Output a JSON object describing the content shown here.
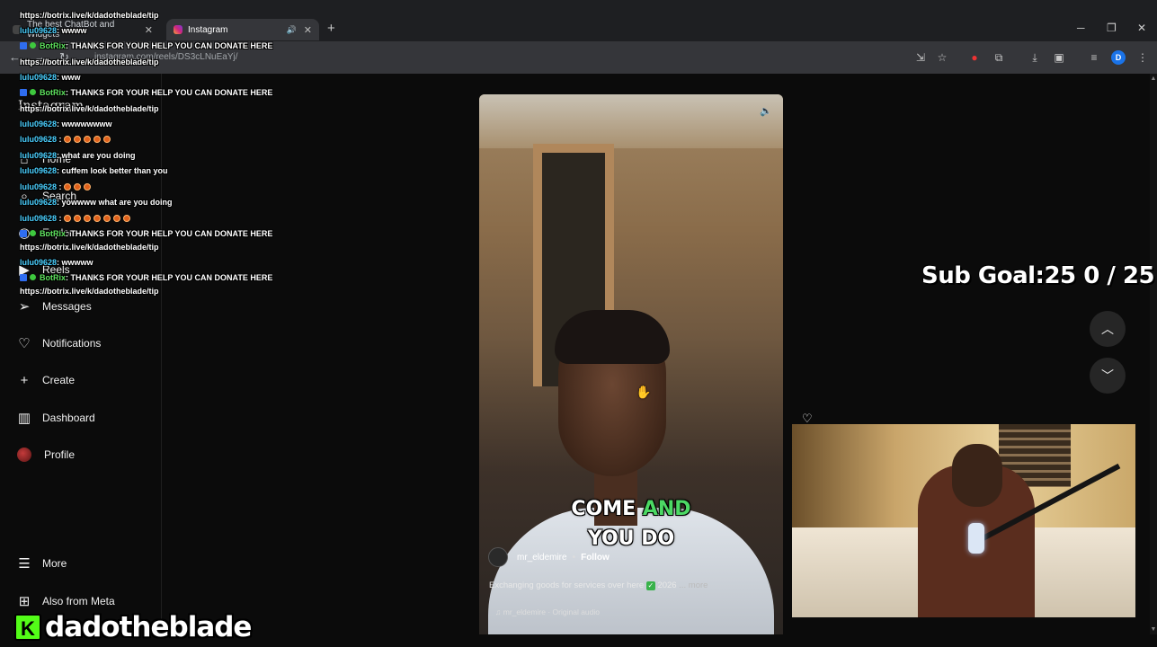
{
  "browser": {
    "tabs": [
      {
        "label": "The best ChatBot and Widgets"
      },
      {
        "label": "Instagram"
      }
    ],
    "url": "instagram.com/reels/DS3cLNuEaYj/",
    "profile_initial": "D"
  },
  "instagram": {
    "logo": "Instagram",
    "nav": [
      {
        "label": "Home"
      },
      {
        "label": "Search"
      },
      {
        "label": "Explore"
      },
      {
        "label": "Reels"
      },
      {
        "label": "Messages"
      },
      {
        "label": "Notifications"
      },
      {
        "label": "Create"
      },
      {
        "label": "Dashboard"
      },
      {
        "label": "Profile"
      }
    ],
    "more_label": "More",
    "meta_label": "Also from Meta",
    "reel": {
      "caption_line1_a": "COME ",
      "caption_line1_b": "AND",
      "caption_line2": "YOU DO",
      "username": "mr_eldemire",
      "separator": "•",
      "follow_label": "Follow",
      "description": "Exchanging goods for services over here",
      "desc_year": "2026",
      "more_label": "... more",
      "audio": "mr_eldemire · Original audio"
    }
  },
  "stream": {
    "sub_goal": "Sub Goal:25  0 / 25",
    "brand_name": "dadotheblade",
    "brand_letter": "K",
    "chat": [
      {
        "kind": "link",
        "text": "https://botrix.live/k/dadotheblade/tip"
      },
      {
        "kind": "msg",
        "user": "lulu09628",
        "text": ": wwww"
      },
      {
        "kind": "bot",
        "user": "BotRix",
        "text": ": THANKS FOR YOUR HELP YOU CAN DONATE HERE"
      },
      {
        "kind": "link",
        "text": "https://botrix.live/k/dadotheblade/tip"
      },
      {
        "kind": "msg",
        "user": "lulu09628",
        "text": ": www"
      },
      {
        "kind": "bot",
        "user": "BotRix",
        "text": ": THANKS FOR YOUR HELP YOU CAN DONATE HERE"
      },
      {
        "kind": "link",
        "text": "https://botrix.live/k/dadotheblade/tip"
      },
      {
        "kind": "msg",
        "user": "lulu09628",
        "text": ": wwwwwwww"
      },
      {
        "kind": "emoji",
        "user": "lulu09628",
        "count": 5
      },
      {
        "kind": "msg",
        "user": "lulu09628",
        "text": ": what are you doing"
      },
      {
        "kind": "msg",
        "user": "lulu09628",
        "text": ": cuffem look better than you"
      },
      {
        "kind": "emoji",
        "user": "lulu09628",
        "count": 3
      },
      {
        "kind": "msg",
        "user": "lulu09628",
        "text": ": yowwww what are you doing"
      },
      {
        "kind": "emoji",
        "user": "lulu09628",
        "count": 7
      },
      {
        "kind": "bot",
        "user": "BotRix",
        "text": ": THANKS FOR YOUR HELP YOU CAN DONATE HERE"
      },
      {
        "kind": "link",
        "text": "https://botrix.live/k/dadotheblade/tip"
      },
      {
        "kind": "msg",
        "user": "lulu09628",
        "text": ": wwwww"
      },
      {
        "kind": "bot",
        "user": "BotRix",
        "text": ": THANKS FOR YOUR HELP YOU CAN DONATE HERE"
      },
      {
        "kind": "link",
        "text": "https://botrix.live/k/dadotheblade/tip"
      }
    ]
  },
  "colors": {
    "kick_green": "#53fc18",
    "chat_user": "#4ad0ff",
    "chat_bot": "#5fe35f",
    "caption_highlight": "#4cd964"
  }
}
